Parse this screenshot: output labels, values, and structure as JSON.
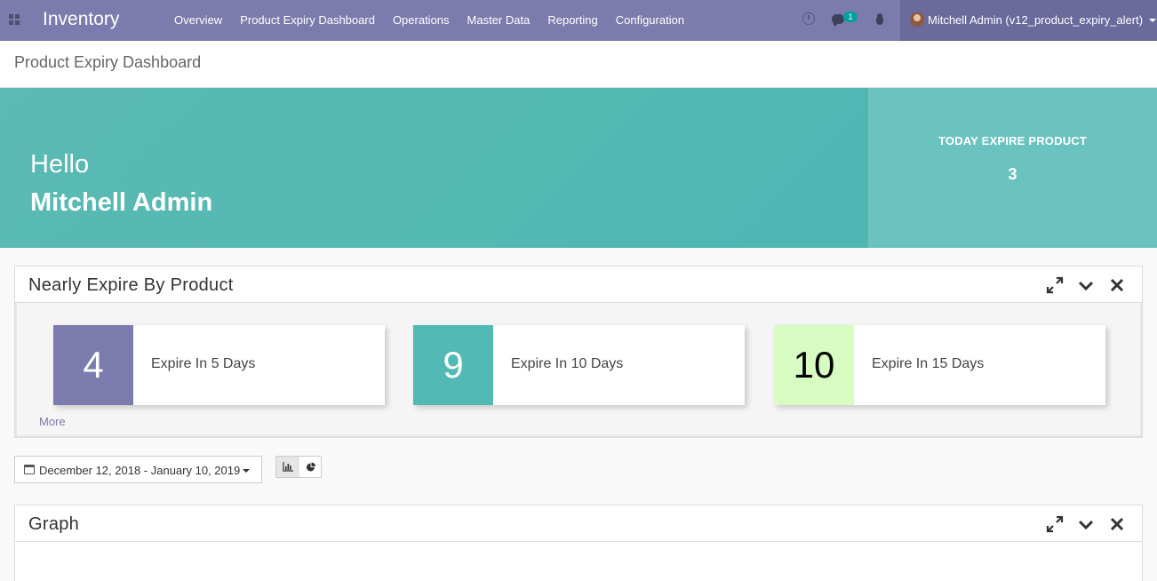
{
  "navbar": {
    "app_title": "Inventory",
    "menu": [
      "Overview",
      "Product Expiry Dashboard",
      "Operations",
      "Master Data",
      "Reporting",
      "Configuration"
    ],
    "chat_badge": "1",
    "user": "Mitchell Admin (v12_product_expiry_alert)"
  },
  "breadcrumb": "Product Expiry Dashboard",
  "hero": {
    "greeting": "Hello",
    "name": "Mitchell Admin",
    "today_label": "TODAY EXPIRE PRODUCT",
    "today_value": "3"
  },
  "nearly_expire": {
    "title": "Nearly Expire By Product",
    "cards": [
      {
        "value": "4",
        "label": "Expire In 5 Days",
        "color": "#7c7bad",
        "text_color": "#ffffff"
      },
      {
        "value": "9",
        "label": "Expire In 10 Days",
        "color": "#52b9b4",
        "text_color": "#ffffff"
      },
      {
        "value": "10",
        "label": "Expire In 15 Days",
        "color": "#d7fbc0",
        "text_color": "#000000"
      }
    ],
    "more_label": "More"
  },
  "date_range": "December 12, 2018 - January 10, 2019",
  "chart_toggles": {
    "active": "bar-chart-icon"
  },
  "graph": {
    "title": "Graph"
  },
  "colors": {
    "navbar": "#7c7bad",
    "hero": "#52b8b3",
    "today_box": "#6bc3bf",
    "accent": "#7c7bad"
  }
}
